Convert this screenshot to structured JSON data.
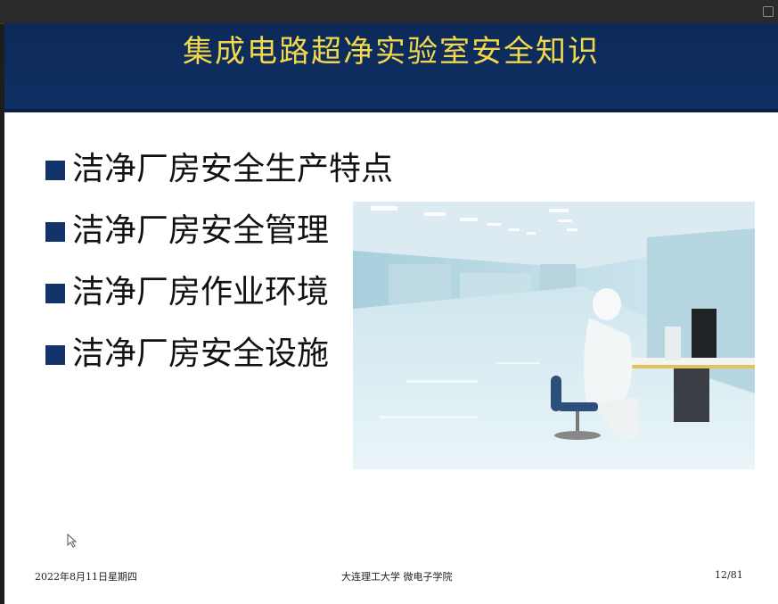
{
  "slide": {
    "title": "集成电路超净实验室安全知识",
    "bullets": [
      {
        "label": "洁净厂房安全生产特点"
      },
      {
        "label": "洁净厂房安全管理"
      },
      {
        "label": "洁净厂房作业环境"
      },
      {
        "label": "洁净厂房安全设施"
      }
    ],
    "footer": {
      "date": "2022年8月11日星期四",
      "center": "大连理工大学 微电子学院",
      "page": "12/81"
    }
  },
  "colors": {
    "title_band": "#0e2f63",
    "title_text": "#f3d84b",
    "bullet_marker": "#13336b"
  }
}
